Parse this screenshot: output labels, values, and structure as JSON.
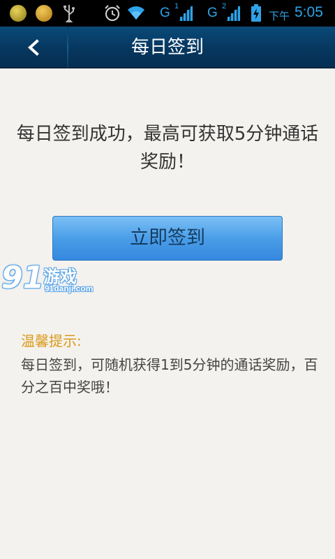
{
  "status_bar": {
    "network_1": "G",
    "network_2": "G",
    "sim_1": "1",
    "sim_2": "2",
    "ampm": "下午",
    "time": "5:05",
    "icons": [
      "app-notification-icon",
      "app-notification-icon",
      "usb-icon",
      "alarm-icon",
      "wifi-icon",
      "signal-icon",
      "battery-charging-icon"
    ]
  },
  "header": {
    "title": "每日签到",
    "back_icon": "chevron-left-icon"
  },
  "main": {
    "headline": "每日签到成功，最高可获取5分钟通话奖励！",
    "checkin_button": "立即签到"
  },
  "watermark": {
    "logo_number": "91",
    "logo_text": "游戏",
    "logo_url": "91danji.com"
  },
  "tips": {
    "label": "温馨提示:",
    "text": "每日签到，可随机获得1到5分钟的通话奖励，百分之百中奖哦！"
  },
  "colors": {
    "status_icon": "#2ea3e8",
    "title_bar": "#06375f",
    "button": "#4a9ee8",
    "tip_label": "#d99a1a",
    "background": "#f4f2ee"
  }
}
